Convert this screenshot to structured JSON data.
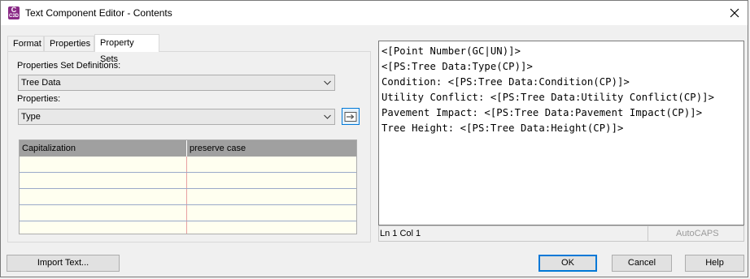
{
  "window": {
    "title": "Text Component Editor - Contents",
    "icon_label_top": "C",
    "icon_label_bottom": "C3D"
  },
  "tabs": [
    {
      "label": "Format",
      "active": false
    },
    {
      "label": "Properties",
      "active": false
    },
    {
      "label": "Property Sets",
      "active": true
    }
  ],
  "property_sets": {
    "definitions_label": "Properties Set Definitions:",
    "definitions_value": "Tree Data",
    "properties_label": "Properties:",
    "properties_value": "Type"
  },
  "grid": {
    "columns": [
      "Capitalization",
      "preserve case"
    ],
    "rows": [
      [
        "",
        ""
      ],
      [
        "",
        ""
      ],
      [
        "",
        ""
      ],
      [
        "",
        ""
      ],
      [
        "",
        ""
      ]
    ]
  },
  "editor": {
    "lines": [
      "<[Point Number(GC|UN)]>",
      "<[PS:Tree Data:Type(CP)]>",
      "Condition: <[PS:Tree Data:Condition(CP)]>",
      "Utility Conflict: <[PS:Tree Data:Utility Conflict(CP)]>",
      "Pavement Impact: <[PS:Tree Data:Pavement Impact(CP)]>",
      "Tree Height: <[PS:Tree Data:Height(CP)]>"
    ]
  },
  "status": {
    "position": "Ln 1 Col 1",
    "caps": "AutoCAPS"
  },
  "buttons": {
    "import": "Import Text...",
    "ok": "OK",
    "cancel": "Cancel",
    "help": "Help"
  },
  "colors": {
    "app_icon": "#8a2a86",
    "grid_background": "#fffff0",
    "grid_header": "#a0a0a0",
    "accent": "#0078d7"
  }
}
